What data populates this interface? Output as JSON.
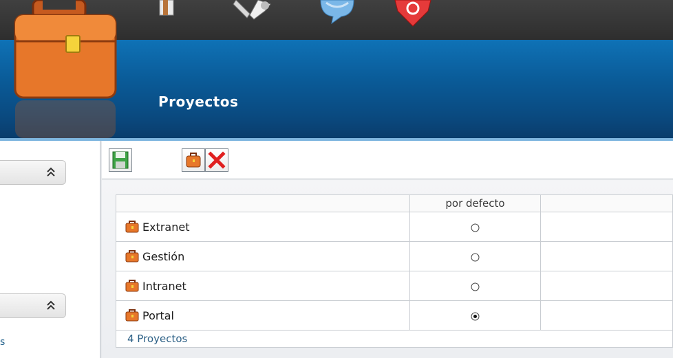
{
  "header": {
    "title": "Proyectos",
    "nav_icons": [
      "document-icon",
      "tools-icon",
      "chat-icon",
      "stop-icon"
    ]
  },
  "sidebar": {
    "panels": [
      {
        "collapse_icon": "double-chevron-up-icon"
      },
      {
        "collapse_icon": "double-chevron-up-icon"
      }
    ],
    "link_fragment": "s"
  },
  "toolbar": {
    "buttons": [
      "save-icon",
      "briefcase-icon",
      "delete-icon"
    ]
  },
  "grid": {
    "columns": [
      "",
      "por defecto",
      ""
    ],
    "rows": [
      {
        "name": "Extranet",
        "default": false
      },
      {
        "name": "Gestión",
        "default": false
      },
      {
        "name": "Intranet",
        "default": false
      },
      {
        "name": "Portal",
        "default": true
      }
    ],
    "footer": "4 Proyectos"
  },
  "colors": {
    "banner": "#0a5b98",
    "header_strip": "#3a3a3a",
    "footer_text": "#2b5f85",
    "delete_red": "#e02020"
  }
}
